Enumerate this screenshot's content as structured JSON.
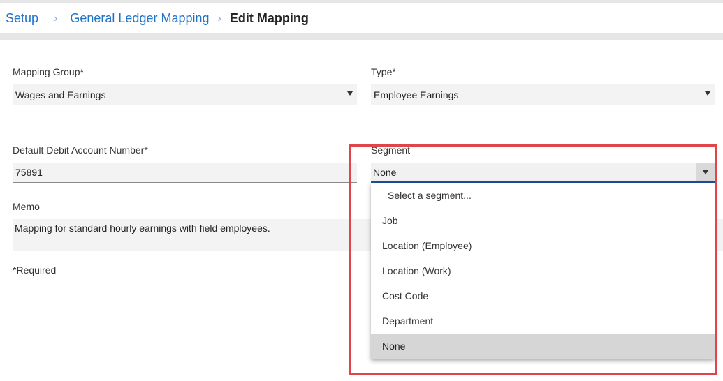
{
  "breadcrumb": {
    "setup": "Setup",
    "separator": "›",
    "gl_mapping": "General Ledger Mapping",
    "current": "Edit Mapping"
  },
  "form": {
    "mapping_group": {
      "label": "Mapping Group*",
      "value": "Wages and Earnings"
    },
    "type": {
      "label": "Type*",
      "value": "Employee Earnings"
    },
    "debit_account": {
      "label": "Default Debit Account Number*",
      "value": "75891"
    },
    "segment": {
      "label": "Segment",
      "value": "None"
    },
    "memo": {
      "label": "Memo",
      "value": "Mapping for standard hourly earnings with field employees."
    },
    "required_note": "*Required"
  },
  "segment_dropdown": {
    "placeholder": "Select a segment...",
    "options": [
      "Job",
      "Location (Employee)",
      "Location (Work)",
      "Cost Code",
      "Department",
      "None"
    ],
    "selected": "None"
  },
  "colors": {
    "link": "#1f73c9",
    "highlight_border": "#e0454a",
    "focus_underline": "#1f4fa3"
  }
}
